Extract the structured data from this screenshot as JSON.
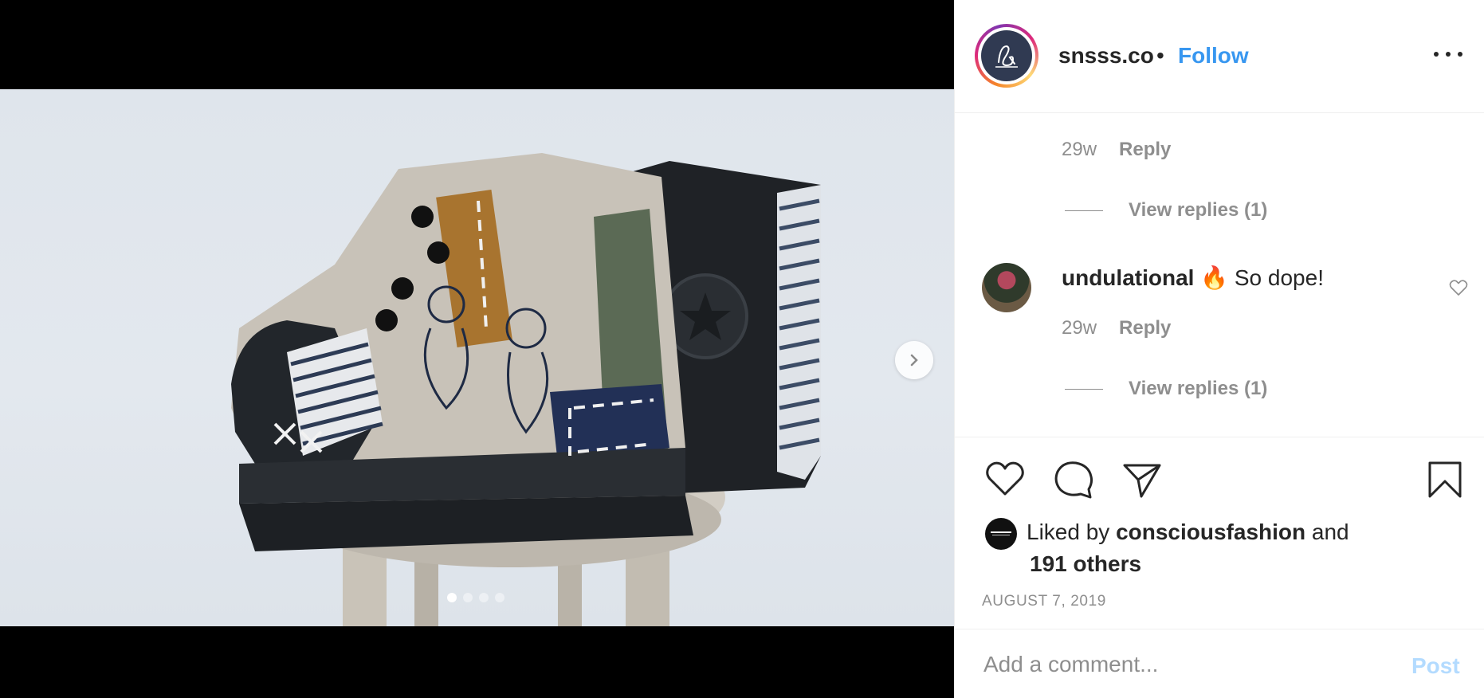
{
  "post": {
    "username": "snsss.co",
    "bullet": "•",
    "follow_label": "Follow",
    "more_icon": "more-options-icon"
  },
  "media": {
    "slide_count": 4,
    "active_slide": 1,
    "next_icon": "chevron-right-icon"
  },
  "comments": {
    "first": {
      "time": "29w",
      "reply_label": "Reply",
      "view_replies": "View replies (1)"
    },
    "second": {
      "username": "undulational",
      "emoji": "🔥",
      "text": "So dope!",
      "time": "29w",
      "reply_label": "Reply",
      "view_replies": "View replies (1)"
    }
  },
  "actions": {
    "like_icon": "heart-icon",
    "comment_icon": "comment-bubble-icon",
    "share_icon": "paper-plane-icon",
    "save_icon": "bookmark-icon"
  },
  "likes": {
    "prefix": "Liked by",
    "user": "consciousfashion",
    "connector": "and",
    "others": "191 others"
  },
  "date": "AUGUST 7, 2019",
  "comment_box": {
    "placeholder": "Add a comment...",
    "post_label": "Post"
  },
  "colors": {
    "accent": "#3897f0",
    "post_disabled": "#b3dbff",
    "muted": "#8e8e8e",
    "text": "#262626"
  }
}
